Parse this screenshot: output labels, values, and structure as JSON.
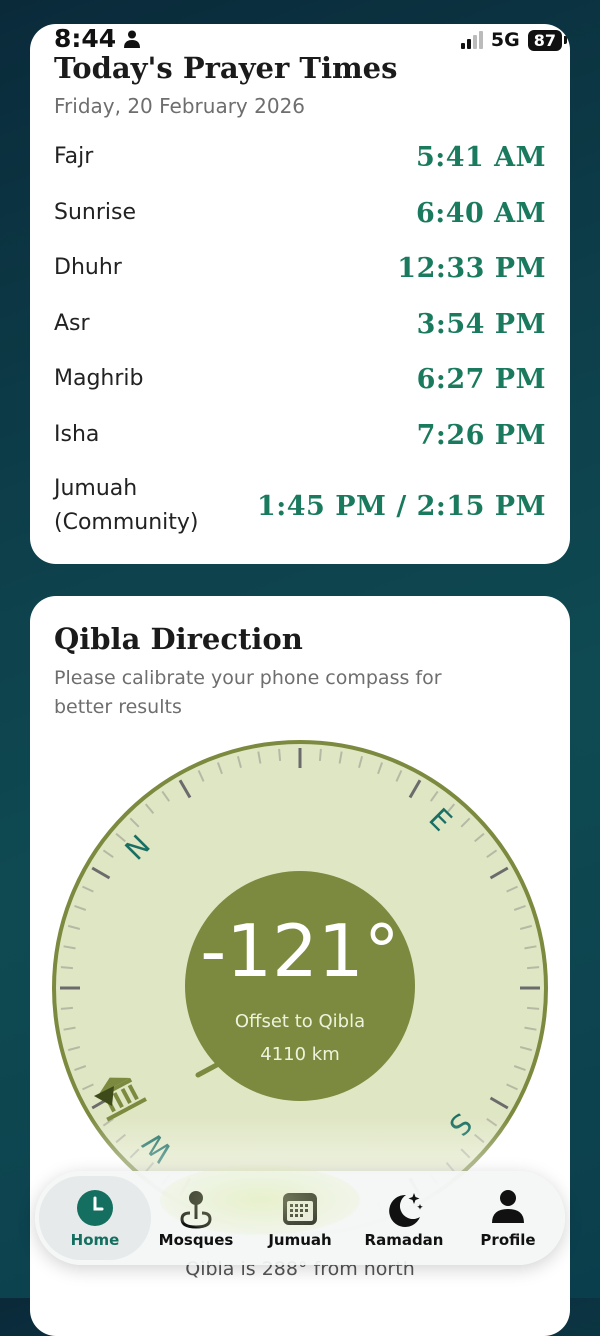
{
  "status_bar": {
    "time": "8:44",
    "network": "5G",
    "battery": "87"
  },
  "prayer": {
    "title": "Today's Prayer Times",
    "date": "Friday, 20 February 2026",
    "rows": [
      {
        "name": "Fajr",
        "time": "5:41 AM"
      },
      {
        "name": "Sunrise",
        "time": "6:40 AM"
      },
      {
        "name": "Dhuhr",
        "time": "12:33 PM"
      },
      {
        "name": "Asr",
        "time": "3:54 PM"
      },
      {
        "name": "Maghrib",
        "time": "6:27 PM"
      },
      {
        "name": "Isha",
        "time": "7:26 PM"
      }
    ],
    "jumuah": {
      "name_line1": "Jumuah",
      "name_line2": "(Community)",
      "time": "1:45 PM / 2:15 PM"
    }
  },
  "qibla": {
    "title": "Qibla Direction",
    "subtitle": "Please calibrate your phone compass for better results",
    "offset": "-121°",
    "offset_label": "Offset to Qibla",
    "distance": "4110 km",
    "north_text": "Qibla is 288° from north",
    "compass_letters": {
      "n": "N",
      "e": "E",
      "s": "S",
      "w": "W"
    },
    "colors": {
      "ring": "#7b8a3e",
      "face": "#dfe6c4",
      "letters": "#1a6f62"
    }
  },
  "tabs": [
    {
      "label": "Home",
      "icon": "clock-icon",
      "active": true
    },
    {
      "label": "Mosques",
      "icon": "map-pin-icon",
      "active": false
    },
    {
      "label": "Jumuah",
      "icon": "calendar-icon",
      "active": false
    },
    {
      "label": "Ramadan",
      "icon": "moon-stars-icon",
      "active": false
    },
    {
      "label": "Profile",
      "icon": "person-icon",
      "active": false
    }
  ]
}
